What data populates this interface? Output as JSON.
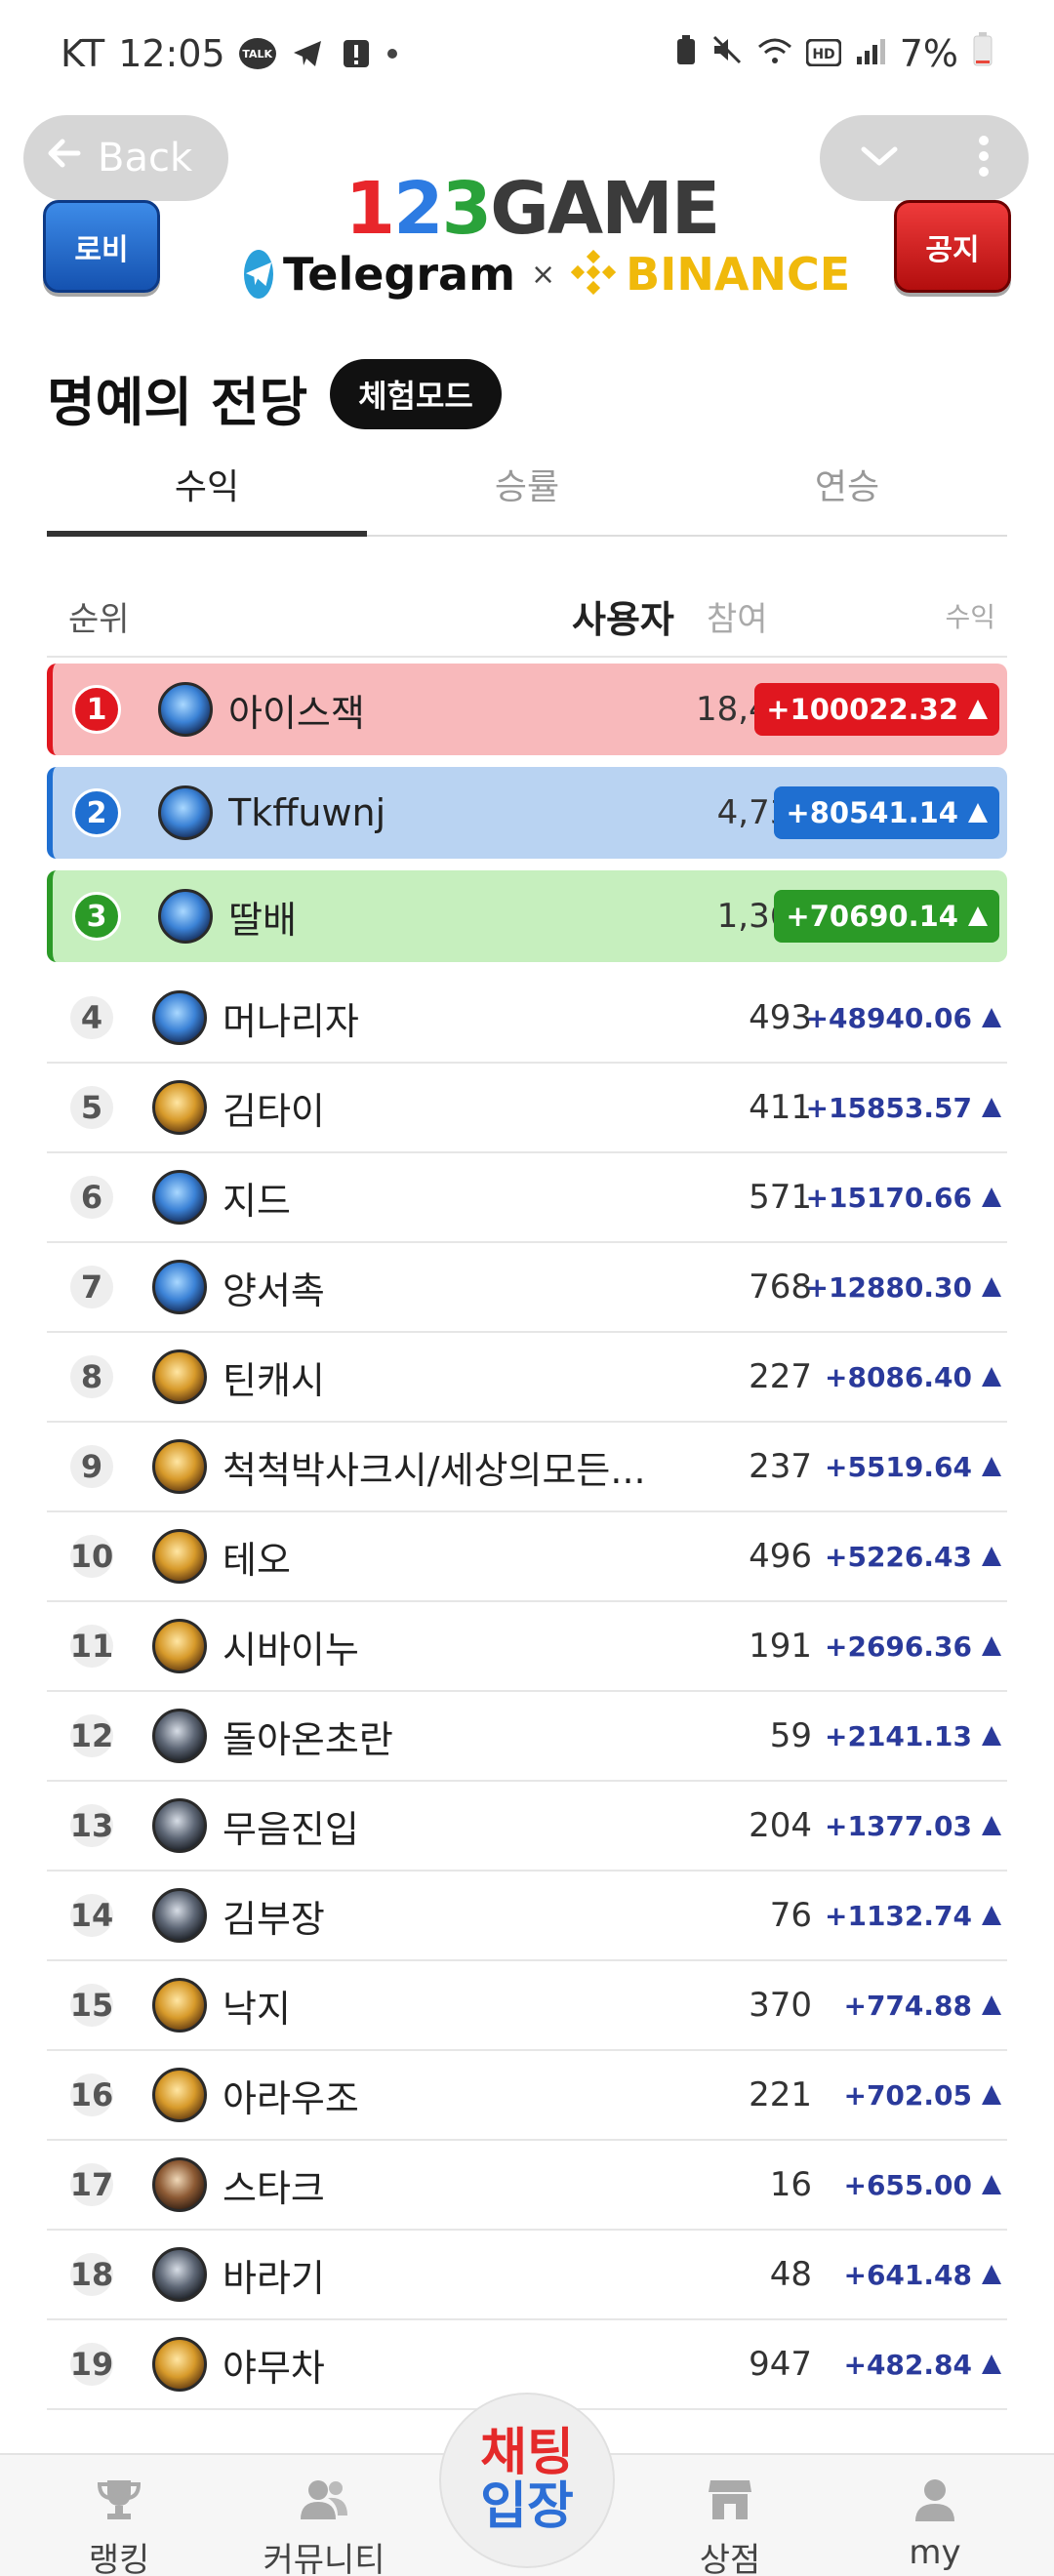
{
  "status_bar": {
    "carrier": "KT",
    "time": "12:05",
    "battery": "7%"
  },
  "header": {
    "back_label": "Back",
    "left_badge": "로비",
    "right_badge": "공지",
    "logo": {
      "d1": "1",
      "d2": "2",
      "d3": "3",
      "word": "GAME"
    },
    "partner_left": "Telegram",
    "partner_x": "×",
    "partner_right": "BINANCE"
  },
  "page": {
    "title": "명예의 전당",
    "mode_chip": "체험모드"
  },
  "tabs": [
    {
      "label": "수익",
      "active": true
    },
    {
      "label": "승률",
      "active": false
    },
    {
      "label": "연승",
      "active": false
    }
  ],
  "columns": {
    "rank": "순위",
    "user": "사용자",
    "participation": "참여",
    "profit": "수익"
  },
  "rows": [
    {
      "rank": "1",
      "name": "아이스잭",
      "participation": "18,490",
      "profit": "+100022.32",
      "avatar": "blue"
    },
    {
      "rank": "2",
      "name": "Tkffuwnj",
      "participation": "4,736",
      "profit": "+80541.14",
      "avatar": "blue"
    },
    {
      "rank": "3",
      "name": "딸배",
      "participation": "1,368",
      "profit": "+70690.14",
      "avatar": "blue"
    },
    {
      "rank": "4",
      "name": "머나리자",
      "participation": "493",
      "profit": "+48940.06",
      "avatar": "blue"
    },
    {
      "rank": "5",
      "name": "김타이",
      "participation": "411",
      "profit": "+15853.57",
      "avatar": "gold"
    },
    {
      "rank": "6",
      "name": "지드",
      "participation": "571",
      "profit": "+15170.66",
      "avatar": "blue"
    },
    {
      "rank": "7",
      "name": "양서촉",
      "participation": "768",
      "profit": "+12880.30",
      "avatar": "blue"
    },
    {
      "rank": "8",
      "name": "틴캐시",
      "participation": "227",
      "profit": "+8086.40",
      "avatar": "gold"
    },
    {
      "rank": "9",
      "name": "척척박사크시/세상의모든...",
      "participation": "237",
      "profit": "+5519.64",
      "avatar": "gold"
    },
    {
      "rank": "10",
      "name": "테오",
      "participation": "496",
      "profit": "+5226.43",
      "avatar": "gold"
    },
    {
      "rank": "11",
      "name": "시바이누",
      "participation": "191",
      "profit": "+2696.36",
      "avatar": "gold"
    },
    {
      "rank": "12",
      "name": "돌아온초란",
      "participation": "59",
      "profit": "+2141.13",
      "avatar": "dark"
    },
    {
      "rank": "13",
      "name": "무음진입",
      "participation": "204",
      "profit": "+1377.03",
      "avatar": "dark"
    },
    {
      "rank": "14",
      "name": "김부장",
      "participation": "76",
      "profit": "+1132.74",
      "avatar": "dark"
    },
    {
      "rank": "15",
      "name": "낙지",
      "participation": "370",
      "profit": "+774.88",
      "avatar": "gold"
    },
    {
      "rank": "16",
      "name": "아라우조",
      "participation": "221",
      "profit": "+702.05",
      "avatar": "gold"
    },
    {
      "rank": "17",
      "name": "스타크",
      "participation": "16",
      "profit": "+655.00",
      "avatar": "brown"
    },
    {
      "rank": "18",
      "name": "바라기",
      "participation": "48",
      "profit": "+641.48",
      "avatar": "dark"
    },
    {
      "rank": "19",
      "name": "야무차",
      "participation": "947",
      "profit": "+482.84",
      "avatar": "gold"
    }
  ],
  "top_colors": [
    {
      "bg": "#f8b9bb",
      "accent": "#e0171f"
    },
    {
      "bg": "#b9d3f2",
      "accent": "#1f6fd1"
    },
    {
      "bg": "#c6efbe",
      "accent": "#2b9a27"
    }
  ],
  "bottom_nav": {
    "ranking": "랭킹",
    "community": "커뮤니티",
    "center_line1": "채팅",
    "center_line2": "입장",
    "shop": "상점",
    "my": "my"
  }
}
